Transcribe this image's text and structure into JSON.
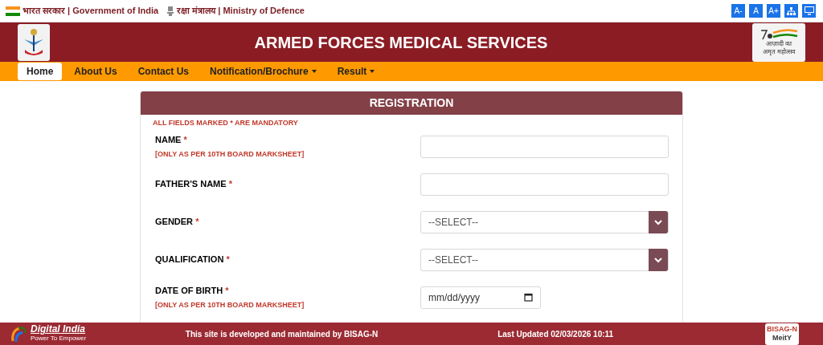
{
  "top_bar": {
    "government": "भारत सरकार | Government of India",
    "ministry": "रक्षा मंत्रालय | Ministry of Defence",
    "font_buttons": [
      "A-",
      "A",
      "A+"
    ]
  },
  "header": {
    "title": "ARMED FORCES MEDICAL SERVICES",
    "badge_lines": [
      "आज़ादी का",
      "अमृत महोत्सव"
    ]
  },
  "nav": [
    {
      "label": "Home",
      "selected": true,
      "dropdown": false
    },
    {
      "label": "About Us",
      "selected": false,
      "dropdown": false
    },
    {
      "label": "Contact Us",
      "selected": false,
      "dropdown": false
    },
    {
      "label": "Notification/Brochure",
      "selected": false,
      "dropdown": true
    },
    {
      "label": "Result",
      "selected": false,
      "dropdown": true
    }
  ],
  "form": {
    "title": "REGISTRATION",
    "notice": "ALL FIELDS MARKED * ARE MANDATORY",
    "fields": [
      {
        "kind": "text",
        "label": "NAME",
        "required_mark": "*",
        "note": "[ONLY AS PER 10TH BOARD MARKSHEET]"
      },
      {
        "kind": "text",
        "label": "FATHER'S NAME",
        "required_mark": "*"
      },
      {
        "kind": "select",
        "label": "GENDER",
        "required_mark": "*",
        "value": "--SELECT--"
      },
      {
        "kind": "select",
        "label": "QUALIFICATION",
        "required_mark": "*",
        "value": "--SELECT--"
      },
      {
        "kind": "date",
        "label": "DATE OF BIRTH",
        "required_mark": "*",
        "placeholder": "mm/dd/yyyy",
        "note": "[ONLY AS PER 10TH BOARD MARKSHEET]"
      }
    ]
  },
  "footer": {
    "brand": "Digital India",
    "tagline": "Power To Empower",
    "credit": "This site is developed and maintained by BISAG-N",
    "updated": "Last Updated 02/03/2026 10:11",
    "logo_lines": [
      "BISAG-N",
      "MeitY"
    ]
  }
}
